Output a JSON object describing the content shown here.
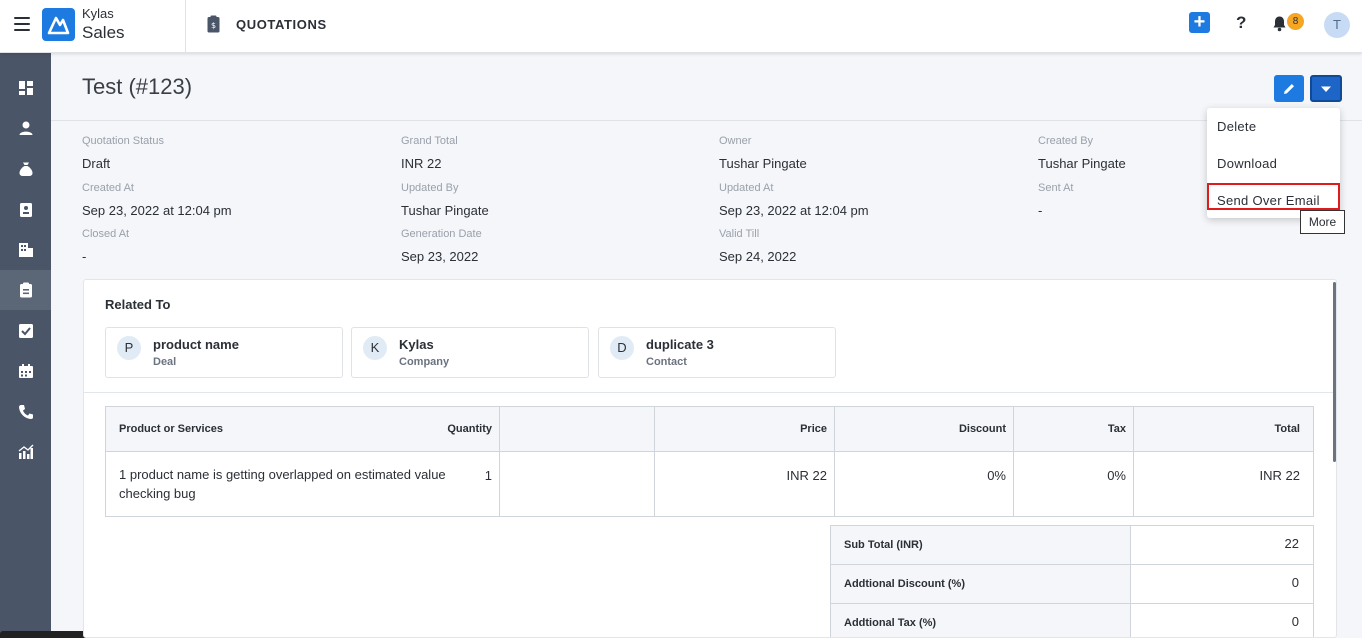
{
  "app": {
    "brand_line1": "Kylas",
    "brand_line2": "Sales",
    "module_title": "QUOTATIONS"
  },
  "topbar": {
    "add_label": "+",
    "help_label": "?",
    "notification_count": "8",
    "avatar_initial": "T"
  },
  "header": {
    "title": "Test (#123)"
  },
  "details": {
    "fields": [
      {
        "label": "Quotation Status",
        "value": "Draft"
      },
      {
        "label": "Grand Total",
        "value": "INR 22"
      },
      {
        "label": "Owner",
        "value": "Tushar Pingate"
      },
      {
        "label": "Created By",
        "value": "Tushar Pingate"
      },
      {
        "label": "Created At",
        "value": "Sep 23, 2022 at 12:04 pm"
      },
      {
        "label": "Updated By",
        "value": "Tushar Pingate"
      },
      {
        "label": "Updated At",
        "value": "Sep 23, 2022 at 12:04 pm"
      },
      {
        "label": "Sent At",
        "value": "-"
      },
      {
        "label": "Closed At",
        "value": "-"
      },
      {
        "label": "Generation Date",
        "value": "Sep 23, 2022"
      },
      {
        "label": "Valid Till",
        "value": "Sep 24, 2022"
      }
    ]
  },
  "dropdown": {
    "items": [
      "Delete",
      "Download",
      "Send Over Email"
    ],
    "tooltip": "More"
  },
  "related": {
    "title": "Related To",
    "items": [
      {
        "initial": "P",
        "name": "product name",
        "type": "Deal"
      },
      {
        "initial": "K",
        "name": "Kylas",
        "type": "Company"
      },
      {
        "initial": "D",
        "name": "duplicate 3",
        "type": "Contact"
      }
    ]
  },
  "products": {
    "headers": [
      "Product or Services",
      "Quantity",
      "Price",
      "Discount",
      "Tax",
      "Total"
    ],
    "rows": [
      [
        "1 product name is getting overlapped on estimated value checking bug",
        "1",
        "INR 22",
        "0%",
        "0%",
        "INR 22"
      ]
    ]
  },
  "summary": {
    "rows": [
      {
        "label": "Sub Total (INR)",
        "value": "22"
      },
      {
        "label": "Addtional Discount (%)",
        "value": "0"
      },
      {
        "label": "Addtional Tax (%)",
        "value": "0"
      }
    ]
  }
}
